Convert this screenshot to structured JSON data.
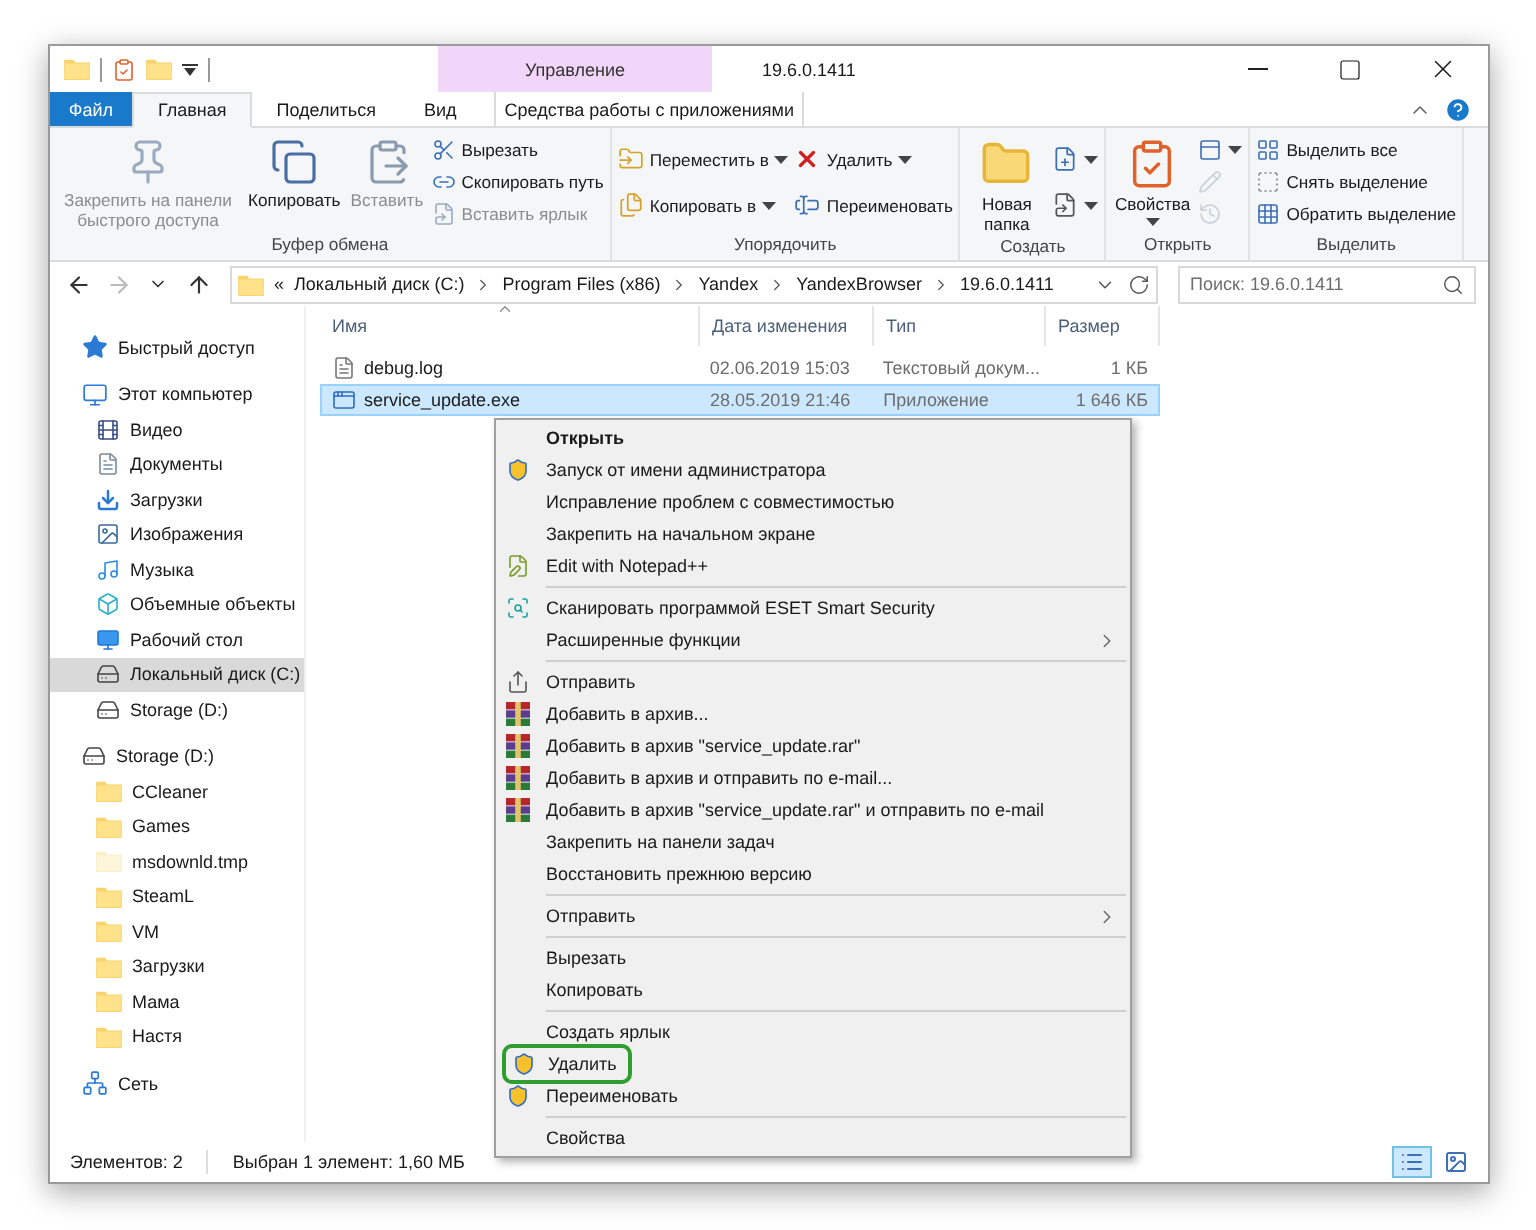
{
  "title_bar": {
    "context_header": "Управление",
    "title": "19.6.0.1411"
  },
  "tabs": [
    {
      "label": "Файл",
      "kind": "file",
      "selected": false
    },
    {
      "label": "Главная",
      "kind": "tab",
      "selected": true
    },
    {
      "label": "Поделиться",
      "kind": "tab",
      "selected": false
    },
    {
      "label": "Вид",
      "kind": "tab",
      "selected": false
    },
    {
      "label": "Средства работы с приложениями",
      "kind": "context",
      "selected": false
    }
  ],
  "ribbon": [
    {
      "label": "Буфер обмена",
      "columns": [
        [
          {
            "label": "Закрепить на панели быстрого доступа",
            "kind": "large",
            "disabled": true,
            "dropdown": false
          }
        ],
        [
          {
            "label": "Копировать",
            "kind": "large",
            "disabled": false,
            "dropdown": false
          }
        ],
        [
          {
            "label": "Вставить",
            "kind": "large",
            "disabled": true,
            "dropdown": false
          }
        ],
        [
          {
            "label": "Вырезать",
            "kind": "small",
            "disabled": false,
            "dropdown": false
          },
          {
            "label": "Скопировать путь",
            "kind": "small",
            "disabled": false,
            "dropdown": false
          },
          {
            "label": "Вставить ярлык",
            "kind": "small",
            "disabled": true,
            "dropdown": false
          }
        ]
      ]
    },
    {
      "label": "Упорядочить",
      "columns": [
        [
          {
            "label": "Переместить в",
            "kind": "small",
            "disabled": false,
            "dropdown": true
          },
          {
            "label": "Копировать в",
            "kind": "small",
            "disabled": false,
            "dropdown": true
          }
        ],
        [
          {
            "label": "Удалить",
            "kind": "small",
            "disabled": false,
            "dropdown": true
          },
          {
            "label": "Переименовать",
            "kind": "small",
            "disabled": false,
            "dropdown": false
          }
        ]
      ]
    },
    {
      "label": "Создать",
      "columns": [
        [
          {
            "label": "Новая папка",
            "kind": "large",
            "disabled": false,
            "dropdown": false
          }
        ],
        [
          {
            "kind": "icon",
            "disabled": false,
            "dropdown": true
          },
          {
            "kind": "icon",
            "disabled": false,
            "dropdown": true
          }
        ]
      ]
    },
    {
      "label": "Открыть",
      "columns": [
        [
          {
            "label": "Свойства",
            "kind": "large",
            "disabled": false,
            "dropdown": true
          }
        ],
        [
          {
            "kind": "icon",
            "disabled": false,
            "dropdown": true
          },
          {
            "kind": "icon",
            "disabled": true,
            "dropdown": false
          },
          {
            "kind": "icon",
            "disabled": true,
            "dropdown": false
          }
        ]
      ]
    },
    {
      "label": "Выделить",
      "columns": [
        [
          {
            "label": "Выделить все",
            "kind": "small",
            "disabled": false,
            "dropdown": false
          },
          {
            "label": "Снять выделение",
            "kind": "small",
            "disabled": false,
            "dropdown": false
          },
          {
            "label": "Обратить выделение",
            "kind": "small",
            "disabled": false,
            "dropdown": false
          }
        ]
      ]
    }
  ],
  "address": {
    "overflow": "«",
    "segments": [
      "Локальный диск (C:)",
      "Program Files (x86)",
      "Yandex",
      "YandexBrowser",
      "19.6.0.1411"
    ]
  },
  "search": {
    "placeholder": "Поиск: 19.6.0.1411"
  },
  "navigation": [
    {
      "label": "Быстрый доступ",
      "selected": false
    },
    {
      "label": "Этот компьютер",
      "selected": false,
      "children": [
        {
          "label": "Видео",
          "selected": false
        },
        {
          "label": "Документы",
          "selected": false
        },
        {
          "label": "Загрузки",
          "selected": false
        },
        {
          "label": "Изображения",
          "selected": false
        },
        {
          "label": "Музыка",
          "selected": false
        },
        {
          "label": "Объемные объекты",
          "selected": false
        },
        {
          "label": "Рабочий стол",
          "selected": false
        },
        {
          "label": "Локальный диск (C:)",
          "selected": true
        },
        {
          "label": "Storage (D:)",
          "selected": false
        }
      ]
    },
    {
      "label": "Storage (D:)",
      "selected": false,
      "children": [
        {
          "label": "CCleaner",
          "selected": false,
          "hidden": false
        },
        {
          "label": "Games",
          "selected": false,
          "hidden": false
        },
        {
          "label": "msdownld.tmp",
          "selected": false,
          "hidden": true
        },
        {
          "label": "SteamL",
          "selected": false,
          "hidden": false
        },
        {
          "label": "VM",
          "selected": false,
          "hidden": false
        },
        {
          "label": "Загрузки",
          "selected": false,
          "hidden": false
        },
        {
          "label": "Мама",
          "selected": false,
          "hidden": false
        },
        {
          "label": "Настя",
          "selected": false,
          "hidden": false
        }
      ]
    },
    {
      "label": "Сеть",
      "selected": false
    }
  ],
  "table": {
    "columns": [
      "Имя",
      "Дата изменения",
      "Тип",
      "Размер"
    ],
    "rows": [
      {
        "cells": [
          "debug.log",
          "02.06.2019 15:03",
          "Текстовый докум...",
          "1 КБ"
        ],
        "selected": false
      },
      {
        "cells": [
          "service_update.exe",
          "28.05.2019 21:46",
          "Приложение",
          "1 646 КБ"
        ],
        "selected": true
      }
    ]
  },
  "context_menu": [
    [
      {
        "label": "Открыть",
        "kind": "default",
        "highlighted": false
      },
      {
        "label": "Запуск от имени администратора",
        "kind": "item",
        "highlighted": false
      },
      {
        "label": "Исправление проблем с совместимостью",
        "kind": "item",
        "highlighted": false
      },
      {
        "label": "Закрепить на начальном экране",
        "kind": "item",
        "highlighted": false
      },
      {
        "label": "Edit with Notepad++",
        "kind": "item",
        "highlighted": false
      }
    ],
    [
      {
        "label": "Сканировать программой ESET Smart Security",
        "kind": "item",
        "highlighted": false
      },
      {
        "label": "Расширенные функции",
        "kind": "submenu",
        "highlighted": false
      }
    ],
    [
      {
        "label": "Отправить",
        "kind": "item",
        "highlighted": false
      },
      {
        "label": "Добавить в архив...",
        "kind": "item",
        "highlighted": false
      },
      {
        "label": "Добавить в архив \"service_update.rar\"",
        "kind": "item",
        "highlighted": false
      },
      {
        "label": "Добавить в архив и отправить по e-mail...",
        "kind": "item",
        "highlighted": false
      },
      {
        "label": "Добавить в архив \"service_update.rar\" и отправить по e-mail",
        "kind": "item",
        "highlighted": false
      },
      {
        "label": "Закрепить на панели задач",
        "kind": "item",
        "highlighted": false
      },
      {
        "label": "Восстановить прежнюю версию",
        "kind": "item",
        "highlighted": false
      }
    ],
    [
      {
        "label": "Отправить",
        "kind": "submenu",
        "highlighted": false
      }
    ],
    [
      {
        "label": "Вырезать",
        "kind": "item",
        "highlighted": false
      },
      {
        "label": "Копировать",
        "kind": "item",
        "highlighted": false
      }
    ],
    [
      {
        "label": "Создать ярлык",
        "kind": "item",
        "highlighted": false
      },
      {
        "label": "Удалить",
        "kind": "item",
        "highlighted": true
      },
      {
        "label": "Переименовать",
        "kind": "item",
        "highlighted": false
      }
    ],
    [
      {
        "label": "Свойства",
        "kind": "item",
        "highlighted": false
      }
    ]
  ],
  "status_bar": {
    "items_count": "Элементов: 2",
    "selection": "Выбран 1 элемент: 1,60 МБ"
  },
  "view_modes": [
    {
      "selected": true
    },
    {
      "selected": false
    }
  ]
}
